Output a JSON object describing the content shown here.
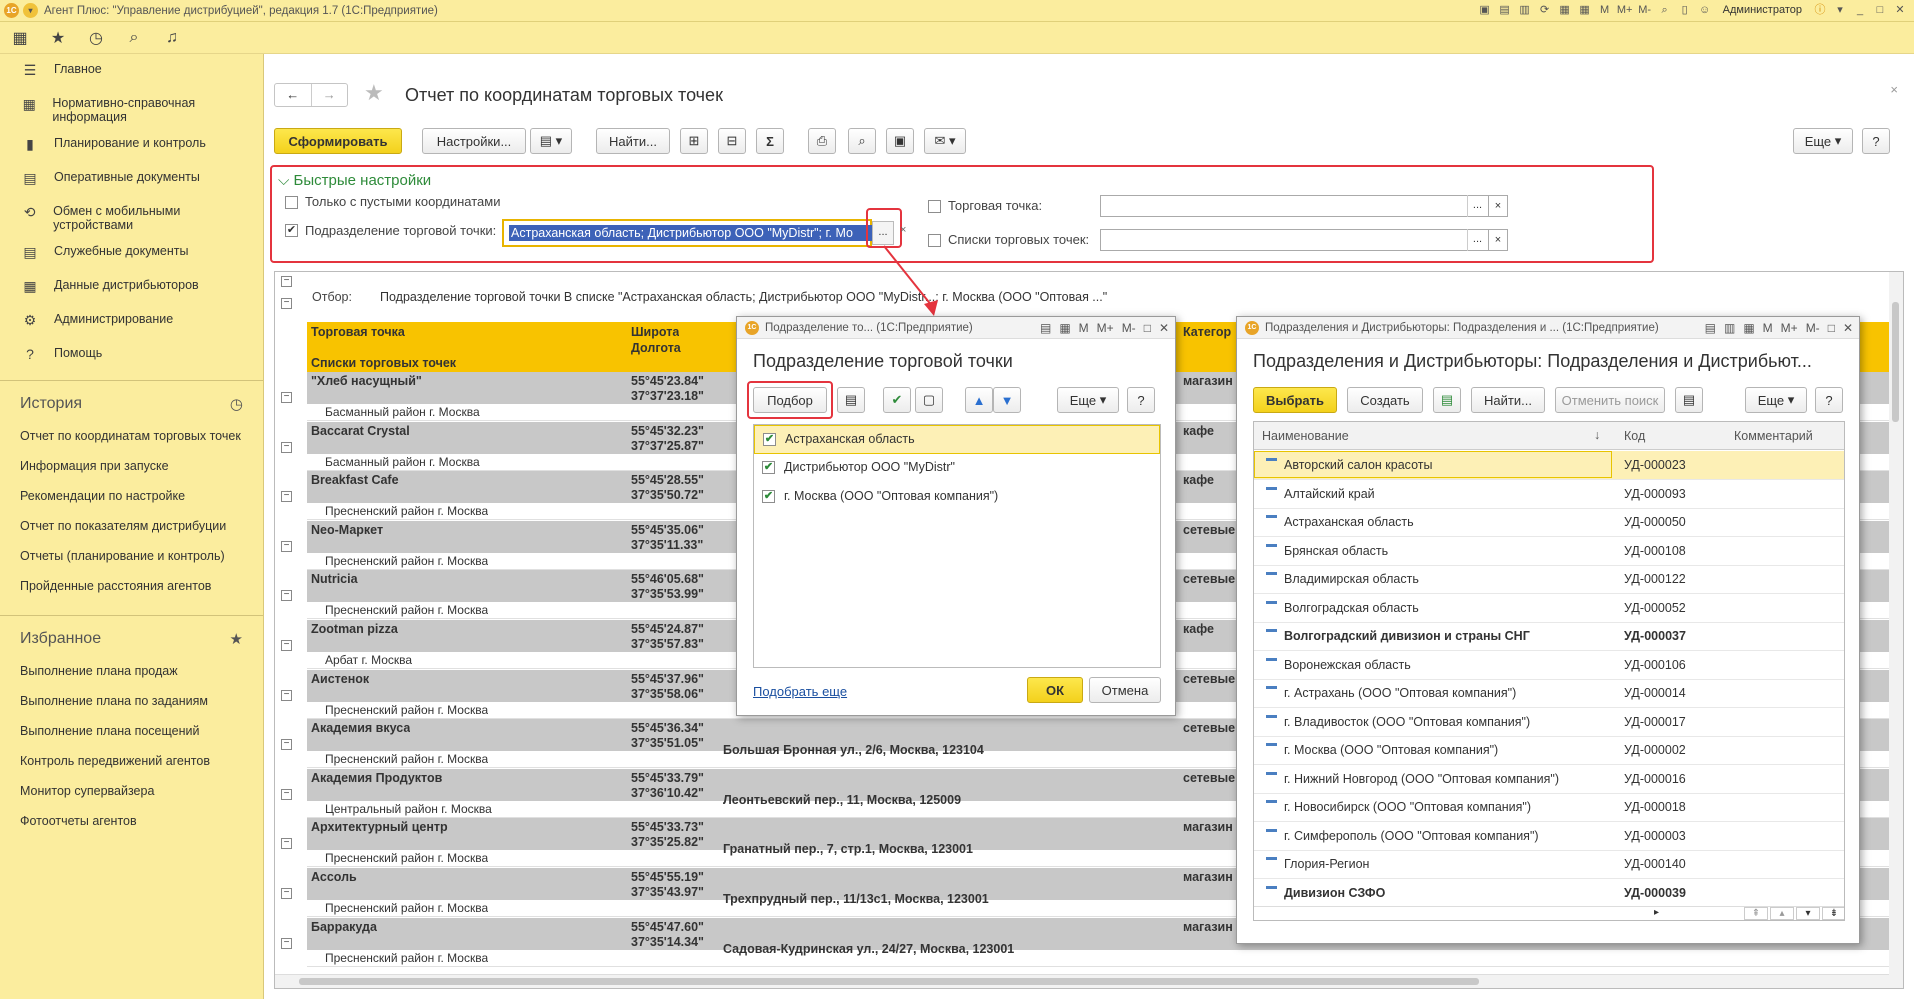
{
  "titlebar": {
    "title": "Агент Плюс: \"Управление дистрибуцией\", редакция 1.7  (1С:Предприятие)",
    "user": "Администратор"
  },
  "sidebar": {
    "items": [
      {
        "icon": "list-icon",
        "glyph": "☰",
        "label": "Главное"
      },
      {
        "icon": "reference-icon",
        "glyph": "▦",
        "label": "Нормативно-справочная информация"
      },
      {
        "icon": "chart-icon",
        "glyph": "▮",
        "label": "Планирование и контроль"
      },
      {
        "icon": "documents-icon",
        "glyph": "▤",
        "label": "Оперативные документы"
      },
      {
        "icon": "exchange-icon",
        "glyph": "⟲",
        "label": "Обмен с мобильными устройствами"
      },
      {
        "icon": "service-docs-icon",
        "glyph": "▤",
        "label": "Служебные документы"
      },
      {
        "icon": "distributor-data-icon",
        "glyph": "▦",
        "label": "Данные дистрибьюторов"
      },
      {
        "icon": "gear-icon",
        "glyph": "⚙",
        "label": "Администрирование"
      },
      {
        "icon": "help-icon",
        "glyph": "?",
        "label": "Помощь"
      }
    ],
    "history_title": "История",
    "history": [
      "Отчет по координатам торговых точек",
      "Информация при запуске",
      "Рекомендации по настройке",
      "Отчет по показателям дистрибуции",
      "Отчеты (планирование и контроль)",
      "Пройденные расстояния агентов"
    ],
    "favorites_title": "Избранное",
    "favorites": [
      "Выполнение плана продаж",
      "Выполнение плана по заданиям",
      "Выполнение плана посещений",
      "Контроль передвижений агентов",
      "Монитор супервайзера",
      "Фотоотчеты агентов"
    ]
  },
  "main": {
    "title": "Отчет по координатам торговых точек",
    "btn_generate": "Сформировать",
    "btn_settings": "Настройки...",
    "btn_find": "Найти...",
    "btn_more": "Еще",
    "quick_settings": "Быстрые настройки",
    "opt_empty_coords": "Только с пустыми координатами",
    "opt_division": "Подразделение торговой точки:",
    "division_value": "Астраханская область; Дистрибьютор ООО \"MyDistr\"; г. Мо",
    "opt_outlet": "Торговая точка:",
    "opt_outlet_lists": "Списки торговых точек:"
  },
  "report": {
    "filter_label": "Отбор:",
    "filter_text": "Подразделение торговой точки В списке \"Астраханская область; Дистрибьютор ООО \"MyDistr...; г. Москва  (ООО \"Оптовая ...\"",
    "hdr_outlet": "Торговая точка",
    "hdr_lists": "Списки торговых точек",
    "hdr_lat": "Широта",
    "hdr_lon": "Долгота",
    "hdr_cat": "Категор",
    "rows": [
      {
        "name": "\"Хлеб насущный\"",
        "lat": "55°45'23.84\"",
        "lon": "37°37'23.18\"",
        "addr": "",
        "cat": "магазин",
        "sub": "Басманный район г. Москва"
      },
      {
        "name": "Baccarat Crystal",
        "lat": "55°45'32.23\"",
        "lon": "37°37'25.87\"",
        "addr": "",
        "cat": "кафе",
        "sub": "Басманный район г. Москва"
      },
      {
        "name": "Breakfast Cafe",
        "lat": "55°45'28.55\"",
        "lon": "37°35'50.72\"",
        "addr": "",
        "cat": "кафе",
        "sub": "Пресненский район г. Москва"
      },
      {
        "name": "Neo-Маркет",
        "lat": "55°45'35.06\"",
        "lon": "37°35'11.33\"",
        "addr": "",
        "cat": "сетевые",
        "sub": "Пресненский район г. Москва"
      },
      {
        "name": "Nutricia",
        "lat": "55°46'05.68\"",
        "lon": "37°35'53.99\"",
        "addr": "",
        "cat": "сетевые",
        "sub": "Пресненский район г. Москва"
      },
      {
        "name": "Zootman pizza",
        "lat": "55°45'24.87\"",
        "lon": "37°35'57.83\"",
        "addr": "",
        "cat": "кафе",
        "sub": "Арбат г. Москва"
      },
      {
        "name": "Аистенок",
        "lat": "55°45'37.96\"",
        "lon": "37°35'58.06\"",
        "addr": "",
        "cat": "сетевые",
        "sub": "Пресненский район г. Москва"
      },
      {
        "name": "Академия вкуса",
        "lat": "55°45'36.34\"",
        "lon": "37°35'51.05\"",
        "addr": "Большая Бронная ул., 2/6, Москва, 123104",
        "cat": "сетевые",
        "sub": "Пресненский район г. Москва"
      },
      {
        "name": "Академия Продуктов",
        "lat": "55°45'33.79\"",
        "lon": "37°36'10.42\"",
        "addr": "Леонтьевский пер., 11, Москва, 125009",
        "cat": "сетевые",
        "sub": "Центральный район г. Москва"
      },
      {
        "name": "Архитектурный центр",
        "lat": "55°45'33.73\"",
        "lon": "37°35'25.82\"",
        "addr": "Гранатный пер., 7, стр.1, Москва, 123001",
        "cat": "магазин",
        "sub": "Пресненский район г. Москва"
      },
      {
        "name": "Ассоль",
        "lat": "55°45'55.19\"",
        "lon": "37°35'43.97\"",
        "addr": "Трехпрудный пер., 11/13с1, Москва, 123001",
        "cat": "магазин",
        "sub": "Пресненский район г. Москва"
      },
      {
        "name": "Барракуда",
        "lat": "55°45'47.60\"",
        "lon": "37°35'14.34\"",
        "addr": "Садовая-Кудринская ул., 24/27, Москва, 123001",
        "cat": "магазин",
        "sub": "Пресненский район г. Москва"
      }
    ]
  },
  "dialog1": {
    "wtitle": "Подразделение то... (1С:Предприятие)",
    "title": "Подразделение торговой точки",
    "btn_pick": "Подбор",
    "btn_more": "Еще",
    "items": [
      "Астраханская область",
      "Дистрибьютор ООО \"MyDistr\"",
      "г. Москва  (ООО \"Оптовая компания\")"
    ],
    "link_more": "Подобрать еще",
    "btn_ok": "ОК",
    "btn_cancel": "Отмена"
  },
  "dialog2": {
    "wtitle": "Подразделения и Дистрибьюторы: Подразделения и ...  (1С:Предприятие)",
    "title": "Подразделения и Дистрибьюторы: Подразделения и Дистрибьют...",
    "btn_select": "Выбрать",
    "btn_create": "Создать",
    "btn_find": "Найти...",
    "btn_cancel_search": "Отменить поиск",
    "btn_more": "Еще",
    "col_name": "Наименование",
    "col_code": "Код",
    "col_comment": "Комментарий",
    "rows": [
      {
        "name": "Авторский салон красоты",
        "code": "УД-000023",
        "bold": false
      },
      {
        "name": "Алтайский край",
        "code": "УД-000093",
        "bold": false
      },
      {
        "name": "Астраханская область",
        "code": "УД-000050",
        "bold": false
      },
      {
        "name": "Брянская область",
        "code": "УД-000108",
        "bold": false
      },
      {
        "name": "Владимирская область",
        "code": "УД-000122",
        "bold": false
      },
      {
        "name": "Волгоградская область",
        "code": "УД-000052",
        "bold": false
      },
      {
        "name": "Волгоградский дивизион и страны СНГ",
        "code": "УД-000037",
        "bold": true
      },
      {
        "name": "Воронежская область",
        "code": "УД-000106",
        "bold": false
      },
      {
        "name": "г. Астрахань (ООО \"Оптовая компания\")",
        "code": "УД-000014",
        "bold": false
      },
      {
        "name": "г. Владивосток (ООО \"Оптовая компания\")",
        "code": "УД-000017",
        "bold": false
      },
      {
        "name": "г. Москва  (ООО \"Оптовая компания\")",
        "code": "УД-000002",
        "bold": false
      },
      {
        "name": "г. Нижний Новгород (ООО \"Оптовая компания\")",
        "code": "УД-000016",
        "bold": false
      },
      {
        "name": "г. Новосибирск (ООО \"Оптовая компания\")",
        "code": "УД-000018",
        "bold": false
      },
      {
        "name": "г. Симферополь  (ООО \"Оптовая компания\")",
        "code": "УД-000003",
        "bold": false
      },
      {
        "name": "Глория-Регион",
        "code": "УД-000140",
        "bold": false
      },
      {
        "name": "Дивизион СЗФО",
        "code": "УД-000039",
        "bold": true
      }
    ]
  }
}
